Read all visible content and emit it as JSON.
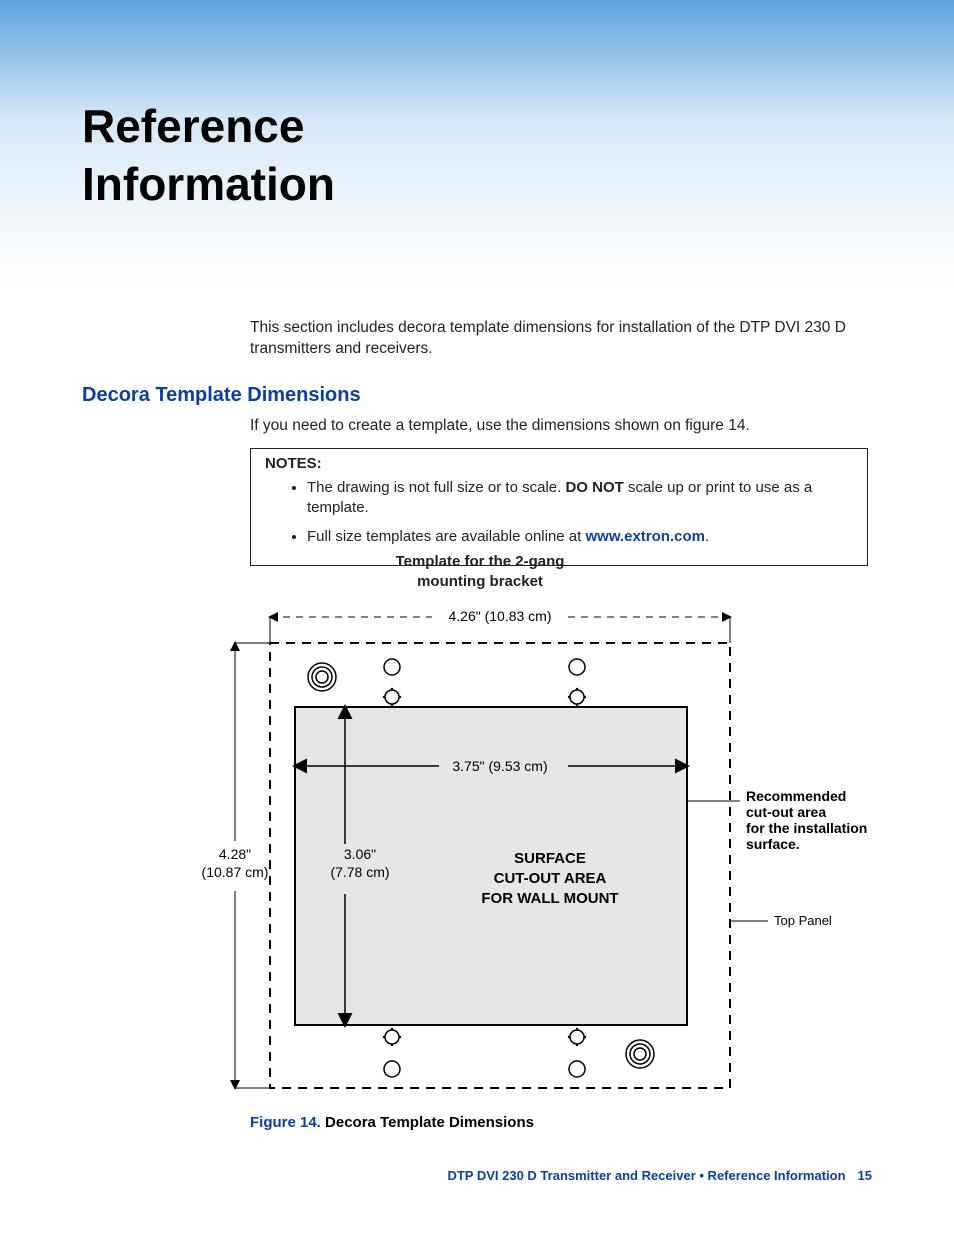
{
  "title_line1": "Reference",
  "title_line2": "Information",
  "intro": "This section includes decora template dimensions for installation of the DTP DVI 230 D transmitters and receivers.",
  "section_heading": "Decora Template Dimensions",
  "section_intro": "If you need to create a template, use the dimensions shown on figure 14.",
  "notes": {
    "label": "NOTES:",
    "item1_pre": "The drawing is not full size or to scale. ",
    "item1_bold": "DO NOT",
    "item1_post": " scale up or print to use as a template.",
    "item2_pre": "Full size templates are available online at ",
    "item2_link": "www.extron.com",
    "item2_post": "."
  },
  "figure": {
    "title_line1": "Template for the 2-gang",
    "title_line2": "mounting bracket",
    "dim_width_outer": "4.26\" (10.83 cm)",
    "dim_height_outer": "4.28\" (10.87 cm)",
    "dim_width_inner": "3.75\" (9.53 cm)",
    "dim_height_inner": "3.06\" (7.78 cm)",
    "cutout_line1": "SURFACE",
    "cutout_line2": "CUT-OUT AREA",
    "cutout_line3": "FOR WALL MOUNT",
    "callout_rec_line1": "Recommended",
    "callout_rec_line2": "cut-out area",
    "callout_rec_line3": "for  the installation",
    "callout_rec_line4": "surface.",
    "callout_top_panel": "Top Panel",
    "caption_label": "Figure 14.",
    "caption_text": "  Decora Template Dimensions"
  },
  "footer": {
    "text": "DTP DVI 230 D Transmitter and Receiver • Reference Information",
    "page": "15"
  }
}
